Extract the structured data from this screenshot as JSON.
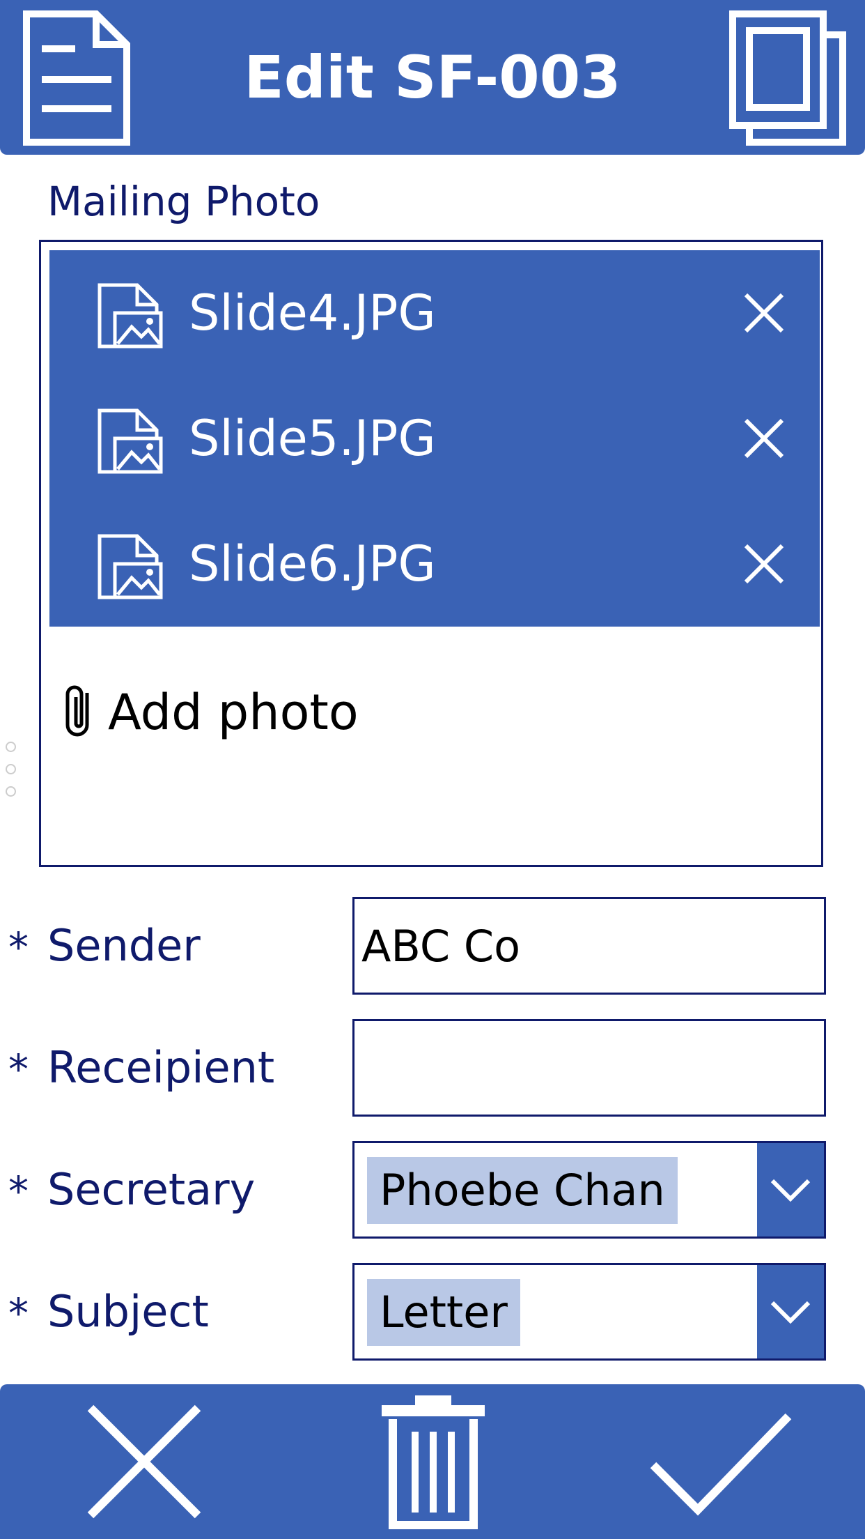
{
  "header": {
    "title": "Edit SF-003",
    "left_icon": "document-icon",
    "right_icon": "copy-icon"
  },
  "photo_section": {
    "label": "Mailing Photo",
    "attachments": [
      {
        "name": "Slide4.JPG",
        "icon": "image-file-icon"
      },
      {
        "name": "Slide5.JPG",
        "icon": "image-file-icon"
      },
      {
        "name": "Slide6.JPG",
        "icon": "image-file-icon"
      }
    ],
    "add_label": "Add photo",
    "add_icon": "paperclip-icon"
  },
  "form": {
    "required_marker": "*",
    "sender": {
      "label": "Sender",
      "value": "ABC Co"
    },
    "recipient": {
      "label": "Receipient",
      "value": ""
    },
    "secretary": {
      "label": "Secretary",
      "value": "Phoebe Chan"
    },
    "subject": {
      "label": "Subject",
      "value": "Letter"
    }
  },
  "footer": {
    "cancel_icon": "close-icon",
    "delete_icon": "trash-icon",
    "submit_icon": "checkmark-icon"
  },
  "colors": {
    "primary": "#3a62b5",
    "label_text": "#0f1a6b",
    "selected_chip": "#b9c8e6",
    "background": "#ffffff"
  }
}
